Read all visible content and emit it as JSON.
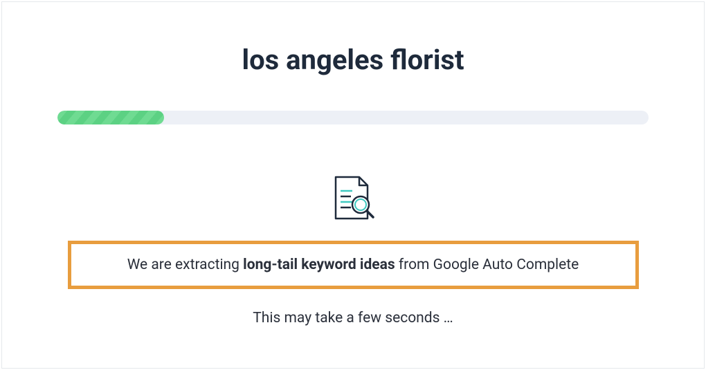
{
  "heading": "los angeles florist",
  "progress": {
    "percent": 18
  },
  "status": {
    "prefix": "We are extracting ",
    "bold": "long-tail keyword ideas",
    "suffix": " from Google Auto Complete"
  },
  "wait_text": "This may take a few seconds …",
  "icon_name": "document-search-icon",
  "colors": {
    "highlight_border": "#e89d3e",
    "progress_fill": "#6fdb92",
    "progress_track": "#edf0f6",
    "text_primary": "#1e2a3b"
  }
}
